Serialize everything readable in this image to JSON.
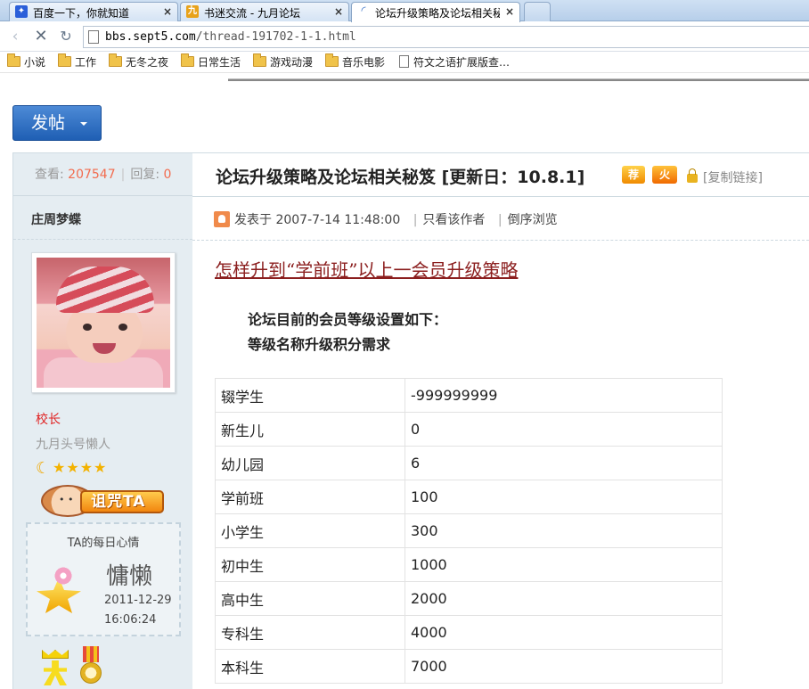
{
  "browser": {
    "tabs": [
      {
        "label": "百度一下，你就知道",
        "active": false
      },
      {
        "label": "书迷交流 - 九月论坛",
        "active": false
      },
      {
        "label": "论坛升级策略及论坛相关秘",
        "active": true
      }
    ],
    "close_glyph": "×",
    "url_domain": "bbs.sept5.com",
    "url_path": "/thread-191702-1-1.html",
    "bookmarks": [
      "小说",
      "工作",
      "无冬之夜",
      "日常生活",
      "游戏动漫",
      "音乐电影",
      "符文之语扩展版查…"
    ]
  },
  "page": {
    "post_button_label": "发帖",
    "stats": {
      "views_label": "查看:",
      "views": "207547",
      "replies_label": "回复:",
      "replies": "0",
      "separator": "|"
    },
    "author": {
      "name": "庄周梦蝶",
      "rank": "校长",
      "custom_title": "九月头号懒人",
      "stars": "★★★★",
      "moon": "☾",
      "visit_label": "诅咒TA"
    },
    "mood": {
      "heading": "TA的每日心情",
      "word": "慵懒",
      "date": "2011-12-29",
      "time": "16:06:24"
    },
    "thread": {
      "title": "论坛升级策略及论坛相关秘笈 [更新日：10.8.1]",
      "badge_recommend": "荐",
      "badge_hot": "火",
      "copy_link": "[复制链接]",
      "posted_label": "发表于",
      "posted_at": "2007-7-14 11:48:00",
      "only_author": "只看该作者",
      "reverse": "倒序浏览",
      "pipe": "|"
    },
    "post": {
      "heading": "怎样升到“学前班”以上一会员升级策略",
      "intro_line1": "论坛目前的会员等级设置如下：",
      "intro_line2": "等级名称升级积分需求",
      "levels": [
        {
          "name": "辍学生",
          "points": "-999999999"
        },
        {
          "name": "新生儿",
          "points": "0"
        },
        {
          "name": "幼儿园",
          "points": "6"
        },
        {
          "name": "学前班",
          "points": "100"
        },
        {
          "name": "小学生",
          "points": "300"
        },
        {
          "name": "初中生",
          "points": "1000"
        },
        {
          "name": "高中生",
          "points": "2000"
        },
        {
          "name": "专科生",
          "points": "4000"
        },
        {
          "name": "本科生",
          "points": "7000"
        }
      ]
    }
  },
  "colors": {
    "accent_blue": "#2a6ac6",
    "stat_number": "#f26c4f",
    "rank_red": "#e02020",
    "heading_red": "#8b1e1e"
  }
}
